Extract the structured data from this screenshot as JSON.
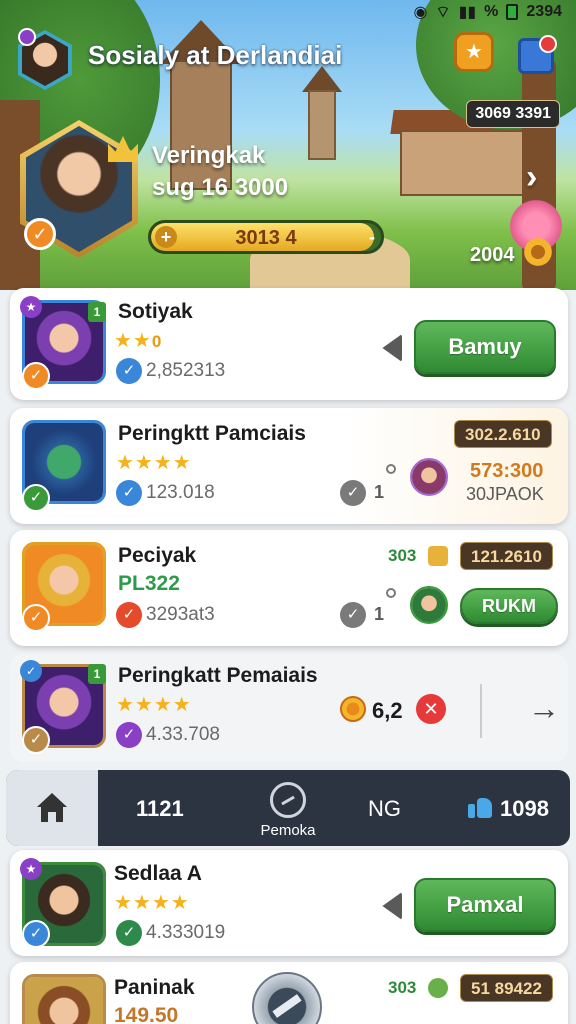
{
  "status_bar": {
    "signal": "%",
    "time": "2394"
  },
  "hero": {
    "title": "Sosialy at Derlandiai",
    "player_name": "Veringkak",
    "player_date": "sug 16 3000",
    "xp_text": "3013 4",
    "xp_progress": 0.97,
    "score": "3069 3391",
    "count": "2004"
  },
  "rows": [
    {
      "name": "Sotiyak",
      "stars_extra": "0",
      "sub": "2,852313",
      "button": "Bamuy"
    },
    {
      "name": "Peringktt Pamciais",
      "sub": "123.018",
      "tag": "302.2.610",
      "score": "573:300",
      "score_sub": "30JPAOK",
      "s_mark": "1"
    },
    {
      "name": "Peciyak",
      "sub_green": "PL322",
      "sub": "3293at3",
      "mini_badge": "303",
      "tag": "121.2610",
      "button": "RUKM",
      "s_mark": "1"
    },
    {
      "name": "Peringkatt Pemaiais",
      "sub": "4.33.708",
      "coin_value": "6,2"
    },
    {
      "name": "Sedlaa A",
      "sub": "4.333019",
      "button": "Pamxal"
    },
    {
      "name": "Paninak",
      "sub_brown": "149.50",
      "mini_badge": "303",
      "tag": "51 89422"
    }
  ],
  "navbar": {
    "left_value": "1121",
    "center_label": "Pemoka",
    "right_text": "NG",
    "likes": "1098"
  }
}
